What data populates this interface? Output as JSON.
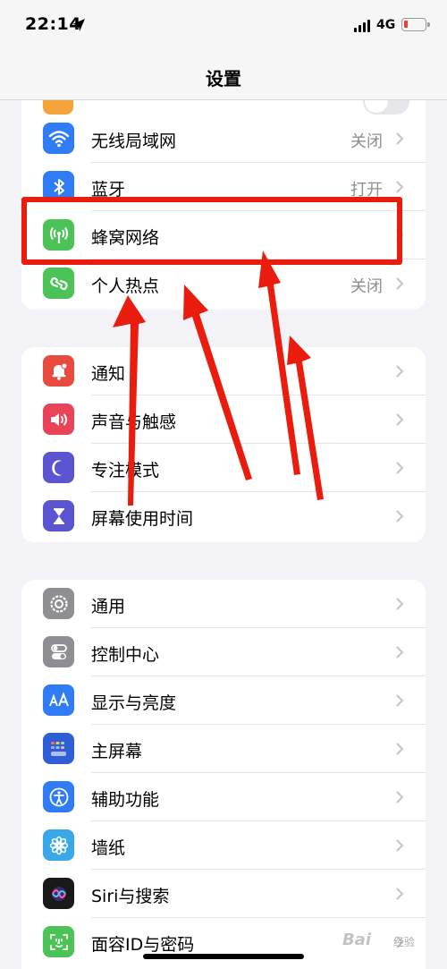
{
  "status_bar": {
    "time": "22:14",
    "network": "4G",
    "icons": [
      "location-arrow-icon",
      "cellular-signal-icon",
      "battery-icon"
    ]
  },
  "header": {
    "title": "设置"
  },
  "groups": [
    {
      "rows": [
        {
          "label": "无线局域网",
          "value": "关闭",
          "icon": "wifi-icon",
          "color": "#2f7cf6"
        },
        {
          "label": "蓝牙",
          "value": "打开",
          "icon": "bluetooth-icon",
          "color": "#2f7cf6"
        },
        {
          "label": "蜂窝网络",
          "value": "",
          "icon": "cellular-antenna-icon",
          "color": "#4cc356"
        },
        {
          "label": "个人热点",
          "value": "关闭",
          "icon": "hotspot-icon",
          "color": "#4cc356"
        }
      ]
    },
    {
      "rows": [
        {
          "label": "通知",
          "icon": "bell-icon",
          "color": "#e84a3f"
        },
        {
          "label": "声音与触感",
          "icon": "speaker-icon",
          "color": "#e9435a"
        },
        {
          "label": "专注模式",
          "icon": "moon-icon",
          "color": "#5b55d1"
        },
        {
          "label": "屏幕使用时间",
          "icon": "hourglass-icon",
          "color": "#5b55d1"
        }
      ]
    },
    {
      "rows": [
        {
          "label": "通用",
          "icon": "gear-icon",
          "color": "#8e8e93"
        },
        {
          "label": "控制中心",
          "icon": "toggles-icon",
          "color": "#8e8e93"
        },
        {
          "label": "显示与亮度",
          "icon": "text-size-icon",
          "color": "#2f7cf6"
        },
        {
          "label": "主屏幕",
          "icon": "home-grid-icon",
          "color": "#2f5fd6"
        },
        {
          "label": "辅助功能",
          "icon": "accessibility-icon",
          "color": "#2f7cf6"
        },
        {
          "label": "墙纸",
          "icon": "flower-icon",
          "color": "#38a8e8"
        },
        {
          "label": "Siri与搜索",
          "icon": "siri-icon",
          "color": "#1a1a1a"
        },
        {
          "label": "面容ID与密码",
          "icon": "face-id-icon",
          "color": "#4cc356"
        }
      ]
    }
  ],
  "watermark": {
    "text": "Bai",
    "sub": "经验"
  },
  "colors": {
    "annotation": "#ea1c0d",
    "background": "#f2f2f7"
  }
}
